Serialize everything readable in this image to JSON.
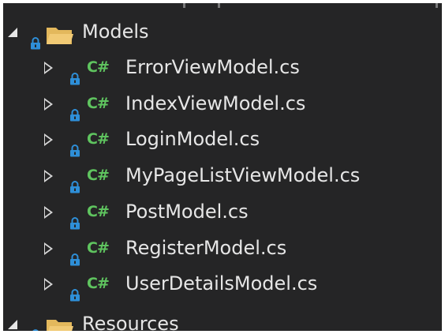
{
  "solution_explorer": {
    "folders": [
      {
        "name": "Models",
        "state": "expanded",
        "icon": "folder-icon",
        "files": [
          {
            "name": "ErrorViewModel.cs",
            "type_badge": "C#",
            "icon": "csharp-file-icon"
          },
          {
            "name": "IndexViewModel.cs",
            "type_badge": "C#",
            "icon": "csharp-file-icon"
          },
          {
            "name": "LoginModel.cs",
            "type_badge": "C#",
            "icon": "csharp-file-icon"
          },
          {
            "name": "MyPageListViewModel.cs",
            "type_badge": "C#",
            "icon": "csharp-file-icon"
          },
          {
            "name": "PostModel.cs",
            "type_badge": "C#",
            "icon": "csharp-file-icon"
          },
          {
            "name": "RegisterModel.cs",
            "type_badge": "C#",
            "icon": "csharp-file-icon"
          },
          {
            "name": "UserDetailsModel.cs",
            "type_badge": "C#",
            "icon": "csharp-file-icon"
          }
        ]
      },
      {
        "name": "Resources",
        "state": "expanded",
        "icon": "folder-icon",
        "files": []
      }
    ],
    "colors": {
      "background": "#252526",
      "text": "#e6e6e6",
      "csharp_badge": "#5fc45f",
      "lock": "#2e8fd8",
      "folder": "#e3b85c"
    }
  }
}
